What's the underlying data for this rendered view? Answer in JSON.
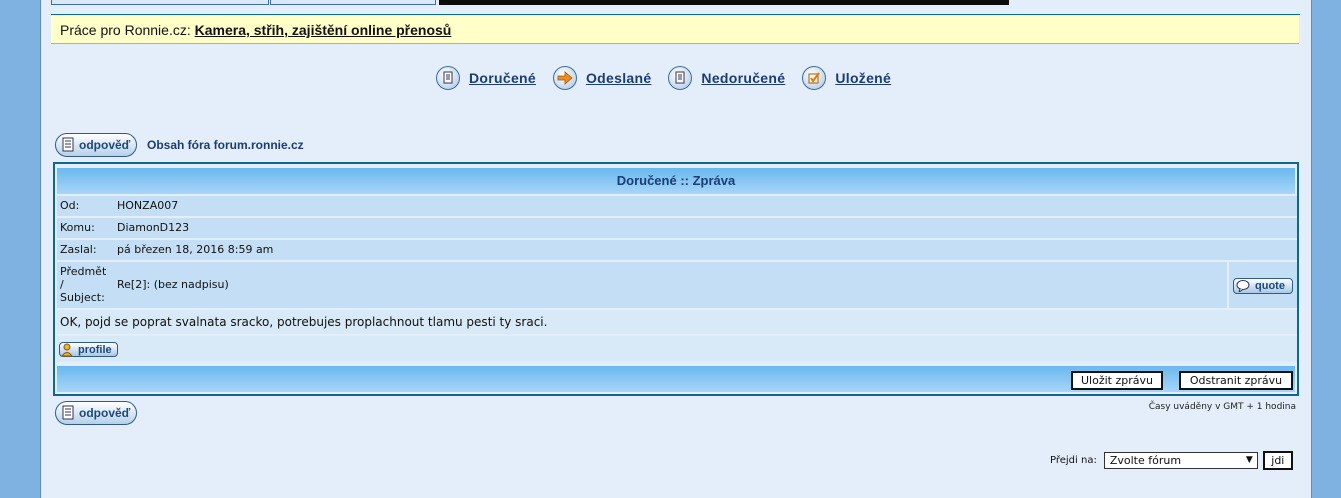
{
  "notice": {
    "prefix": "Práce pro Ronnie.cz:",
    "link": "Kamera, střih, zajištění online přenosů"
  },
  "folders": [
    {
      "label": "Doručené",
      "icon": "inbox-icon"
    },
    {
      "label": "Odeslané",
      "icon": "arrow-right-icon"
    },
    {
      "label": "Nedoručené",
      "icon": "outbox-icon"
    },
    {
      "label": "Uložené",
      "icon": "saved-checkbox-icon"
    }
  ],
  "reply_button": {
    "label": "odpověď"
  },
  "breadcrumb": "Obsah fóra forum.ronnie.cz",
  "message": {
    "header": "Doručené :: Zpráva",
    "from_label": "Od:",
    "from_value": "HONZA007",
    "to_label": "Komu:",
    "to_value": "DiamonD123",
    "sent_label": "Zaslal:",
    "sent_value": "pá březen 18, 2016 8:59 am",
    "subject_label_lines": [
      "Předmět",
      "/",
      "Subject:"
    ],
    "subject_value": "Re[2]: (bez nadpisu)",
    "quote_label": "quote",
    "body": "OK, pojd se poprat svalnata sracko, potrebujes proplachnout tlamu pesti ty sraci.",
    "profile_label": "profile",
    "save_label": "Uložit zprávu",
    "delete_label": "Odstranit zprávu"
  },
  "timezone": "Časy uváděny v GMT + 1 hodina",
  "jump": {
    "label": "Přejdi na:",
    "selected": "Zvolte fórum",
    "go_label": "jdi"
  }
}
